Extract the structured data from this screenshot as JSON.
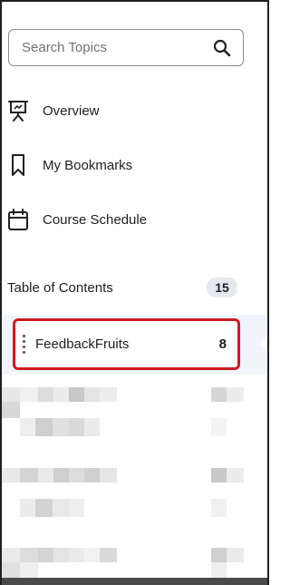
{
  "search": {
    "placeholder": "Search Topics"
  },
  "nav": [
    {
      "label": "Overview",
      "icon": "presentation-icon"
    },
    {
      "label": "My Bookmarks",
      "icon": "bookmark-icon"
    },
    {
      "label": "Course Schedule",
      "icon": "calendar-icon"
    }
  ],
  "toc": {
    "title": "Table of Contents",
    "count": "15"
  },
  "module": {
    "name": "FeedbackFruits",
    "count": "8",
    "highlight_color": "#cd1b22"
  }
}
